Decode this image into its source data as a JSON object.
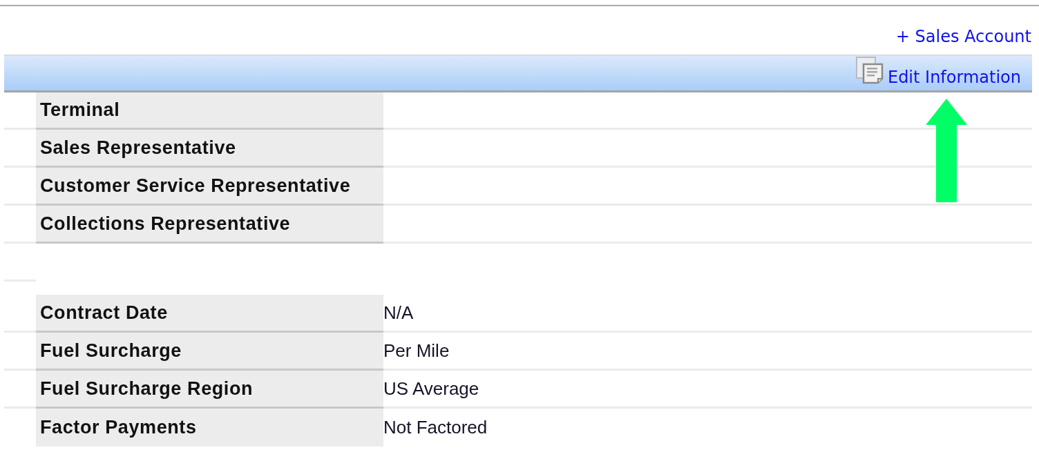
{
  "header": {
    "add_link": "+ Sales Account",
    "edit_link": "Edit Information"
  },
  "sections": [
    {
      "rows": [
        {
          "label": "Terminal"
        },
        {
          "label": "Sales Representative"
        },
        {
          "label": "Customer Service Representative"
        },
        {
          "label": "Collections Representative"
        }
      ]
    },
    {
      "rows": [
        {
          "label": "Contract Date",
          "value": "N/A"
        },
        {
          "label": "Fuel Surcharge",
          "value": "Per Mile"
        },
        {
          "label": "Fuel Surcharge Region",
          "value": "US Average"
        },
        {
          "label": "Factor Payments",
          "value": "Not Factored"
        }
      ]
    }
  ]
}
